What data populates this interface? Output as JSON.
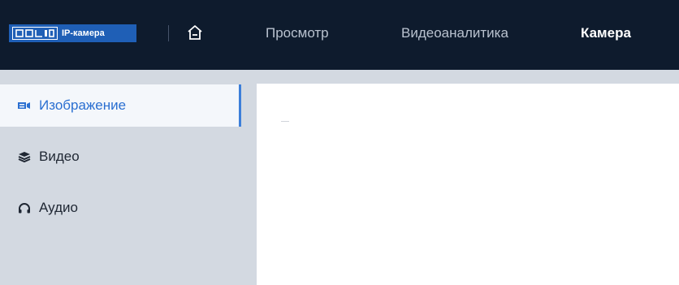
{
  "header": {
    "logo": {
      "brand": "BOLID",
      "product": "IP-камера"
    },
    "nav": [
      {
        "label": "Просмотр",
        "active": false
      },
      {
        "label": "Видеоаналитика",
        "active": false
      },
      {
        "label": "Камера",
        "active": true
      }
    ]
  },
  "sidebar": {
    "items": [
      {
        "label": "Изображение",
        "icon": "camera-icon",
        "active": true
      },
      {
        "label": "Видео",
        "icon": "layers-icon",
        "active": false
      },
      {
        "label": "Аудио",
        "icon": "headphones-icon",
        "active": false
      }
    ]
  },
  "colors": {
    "header_bg": "#0e1b2d",
    "sidebar_bg": "#d3d9e1",
    "accent": "#2a6fd1",
    "logo_bg": "#1f5fb6"
  }
}
